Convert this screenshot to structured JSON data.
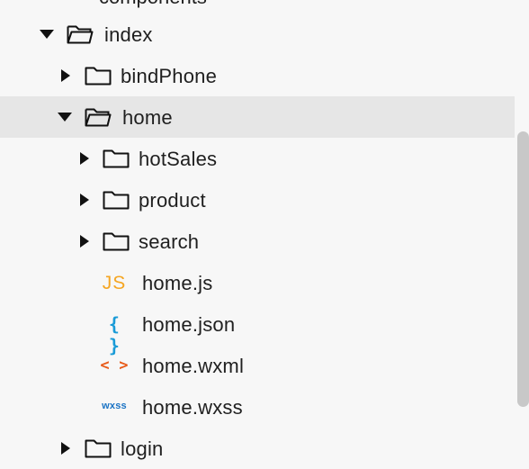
{
  "tree": {
    "top_partial_label": "components",
    "index": {
      "label": "index"
    },
    "bindPhone": {
      "label": "bindPhone"
    },
    "home": {
      "label": "home"
    },
    "hotSales": {
      "label": "hotSales"
    },
    "product": {
      "label": "product"
    },
    "search": {
      "label": "search"
    },
    "files": [
      {
        "icon_text": "JS",
        "label": "home.js"
      },
      {
        "icon_text": "{ }",
        "label": "home.json"
      },
      {
        "icon_text": "< >",
        "label": "home.wxml"
      },
      {
        "icon_text": "wxss",
        "label": "home.wxss"
      }
    ],
    "login": {
      "label": "login"
    }
  },
  "colors": {
    "background": "#f7f7f7",
    "selected_row": "#e6e6e6",
    "js": "#f5a623",
    "json": "#1a9bd7",
    "wxml": "#e85a18",
    "wxss": "#1a73c4",
    "scrollbar": "#c8c8c8"
  }
}
